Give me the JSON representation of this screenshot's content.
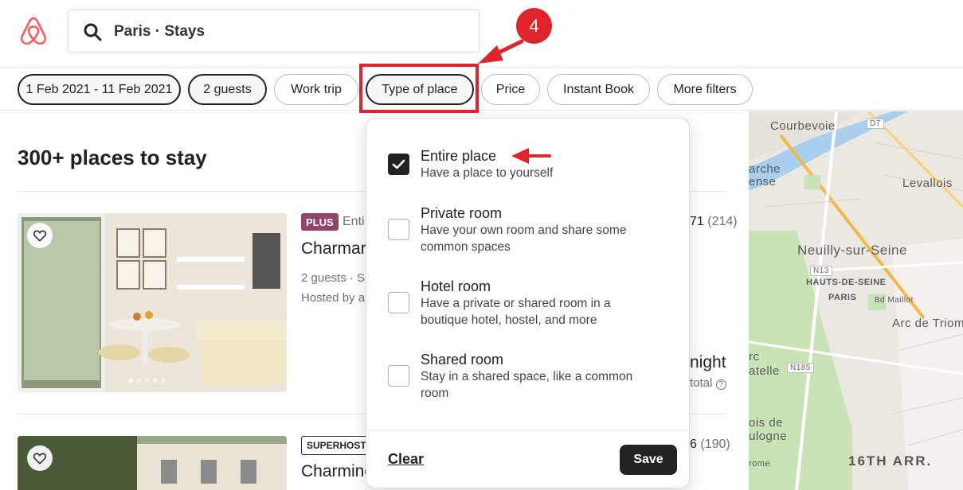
{
  "header": {
    "search_text": "Paris · Stays"
  },
  "filters": [
    {
      "label": "1 Feb 2021 - 11 Feb 2021",
      "active": true
    },
    {
      "label": "2 guests",
      "active": true
    },
    {
      "label": "Work trip",
      "active": false
    },
    {
      "label": "Type of place",
      "active": true
    },
    {
      "label": "Price",
      "active": false
    },
    {
      "label": "Instant Book",
      "active": false
    },
    {
      "label": "More filters",
      "active": false
    }
  ],
  "annotation": {
    "step_number": "4",
    "color": "#e0242b"
  },
  "results": {
    "title": "300+ places to stay",
    "listings": [
      {
        "badge": "PLUS",
        "type": "Enti",
        "title": "Charmar",
        "meta1": "2 guests · S",
        "meta2": "Hosted by a",
        "rating": "71",
        "reviews": "(214)",
        "price": "night",
        "total": "total"
      },
      {
        "badge": "SUPERHOST",
        "title": "Charming",
        "rating": "6",
        "reviews": "(190)"
      }
    ]
  },
  "dropdown": {
    "options": [
      {
        "title": "Entire place",
        "desc": "Have a place to yourself",
        "checked": true
      },
      {
        "title": "Private room",
        "desc": "Have your own room and share some common spaces",
        "checked": false
      },
      {
        "title": "Hotel room",
        "desc": "Have a private or shared room in a boutique hotel, hostel, and more",
        "checked": false
      },
      {
        "title": "Shared room",
        "desc": "Stay in a shared space, like a common room",
        "checked": false
      }
    ],
    "clear_label": "Clear",
    "save_label": "Save"
  },
  "map": {
    "labels": {
      "courbevoie": "Courbevoie",
      "levallois": "Levallois",
      "arche": "arche",
      "ense": "ense",
      "neuilly": "Neuilly-sur-Seine",
      "hauts": "HAUTS-DE-SEINE",
      "paris": "PARIS",
      "arc": "Arc de Triom",
      "rc": "rc",
      "atelle": "atelle",
      "bois": "ois de",
      "ulogne": "ulogne",
      "arr16": "16TH ARR.",
      "rome": "rome",
      "d7": "D7",
      "n13": "N13",
      "n185": "N185",
      "bd": "Bd Maillot"
    }
  },
  "colors": {
    "plus_badge": "#914669",
    "accent_red": "#e0242b",
    "airbnb_logo": "#ff5a5f"
  }
}
